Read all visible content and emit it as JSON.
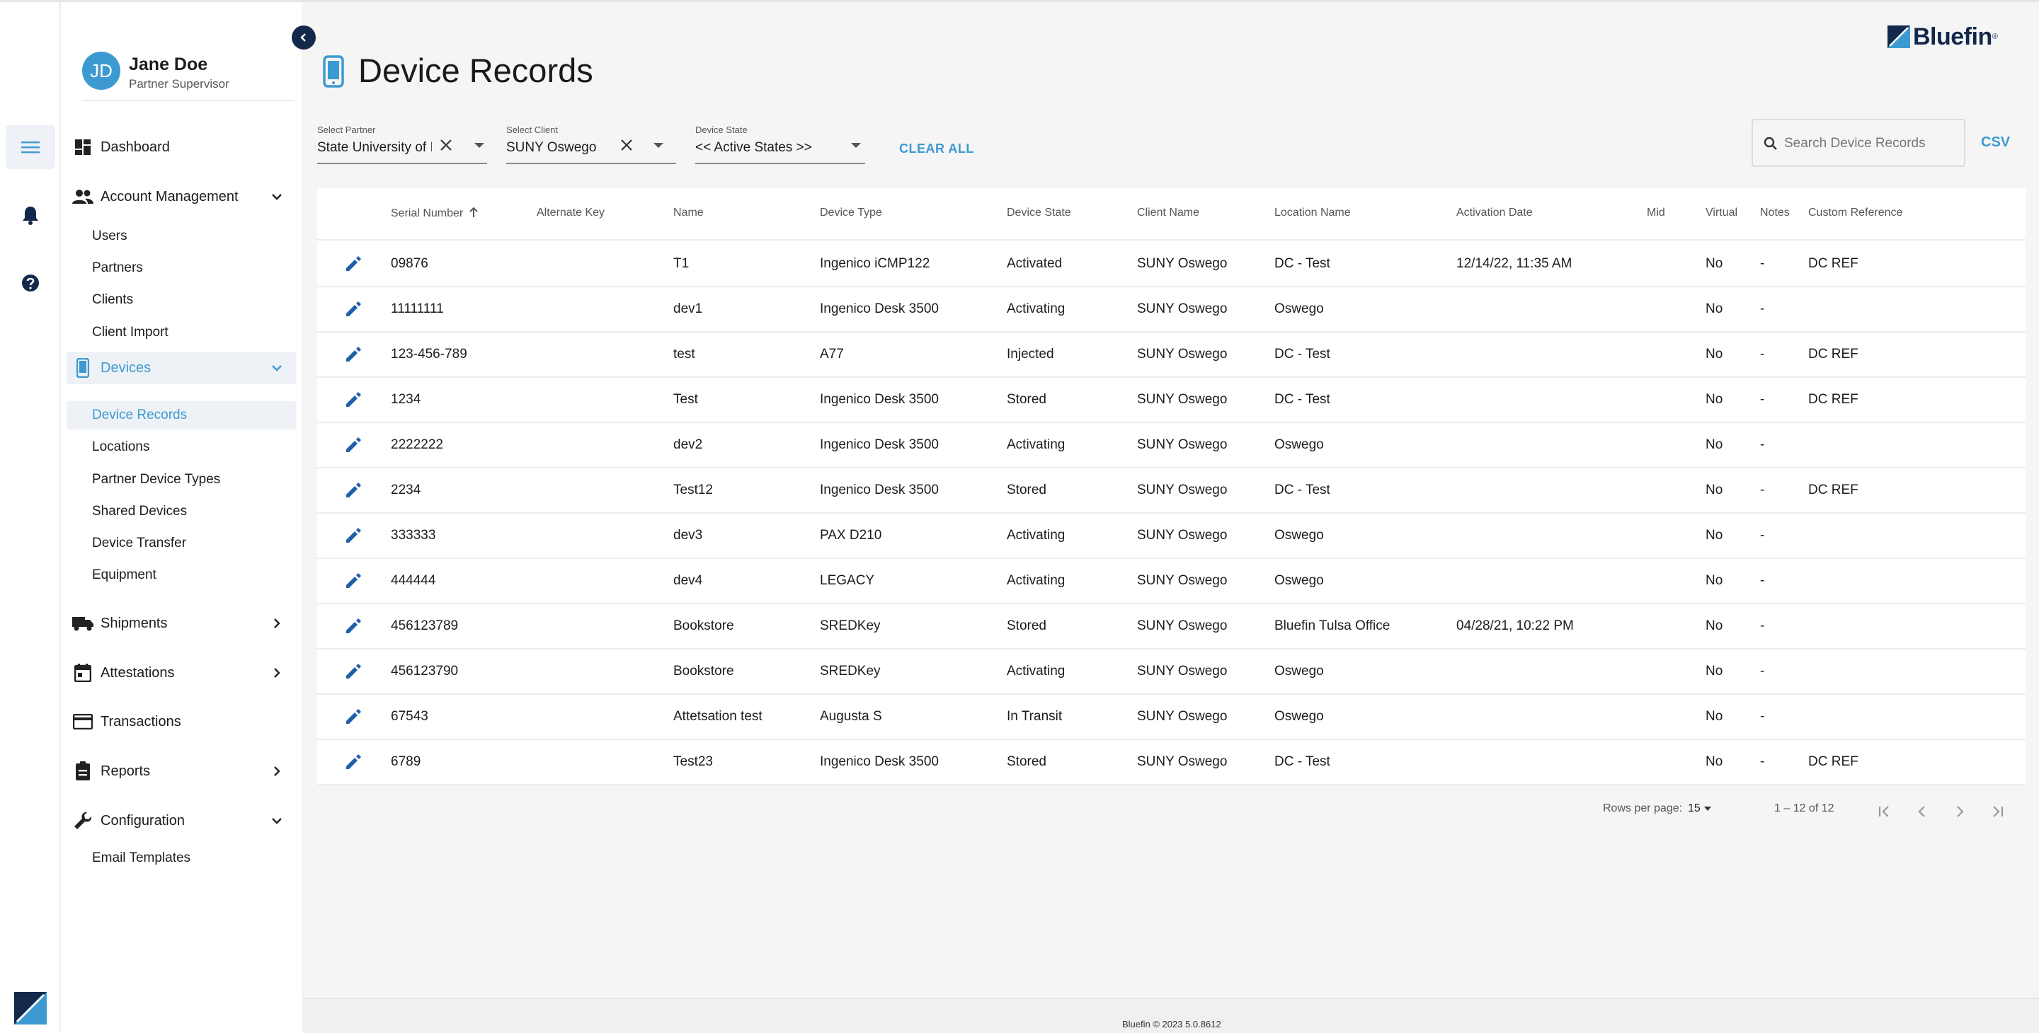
{
  "app": {
    "brand": "Bluefin",
    "brand_reg": "®",
    "footer": "Bluefin © 2023 5.0.8612",
    "colors": {
      "accent": "#3d9ad1",
      "navy": "#13294b",
      "edit_icon": "#1f5fa8"
    }
  },
  "rail": {
    "icons": [
      "menu-icon",
      "bell-icon",
      "help-icon"
    ]
  },
  "user": {
    "initials": "JD",
    "name": "Jane Doe",
    "role": "Partner Supervisor"
  },
  "sidebar": {
    "dashboard": "Dashboard",
    "account_management": "Account Management",
    "users": "Users",
    "partners": "Partners",
    "clients": "Clients",
    "client_import": "Client Import",
    "devices": "Devices",
    "device_records": "Device Records",
    "locations": "Locations",
    "partner_device_types": "Partner Device Types",
    "shared_devices": "Shared Devices",
    "device_transfer": "Device Transfer",
    "equipment": "Equipment",
    "shipments": "Shipments",
    "attestations": "Attestations",
    "transactions": "Transactions",
    "reports": "Reports",
    "configuration": "Configuration",
    "email_templates": "Email Templates"
  },
  "page": {
    "title": "Device Records"
  },
  "filters": {
    "partner": {
      "label": "Select Partner",
      "value": "State University of I"
    },
    "client": {
      "label": "Select Client",
      "value": "SUNY Oswego"
    },
    "state": {
      "label": "Device State",
      "value": "<< Active States >>"
    },
    "clear_all": "CLEAR ALL"
  },
  "search": {
    "placeholder": "Search Device Records"
  },
  "csv": "CSV",
  "table": {
    "headers": {
      "serial": "Serial Number",
      "alt_key": "Alternate Key",
      "name": "Name",
      "device_type": "Device Type",
      "device_state": "Device State",
      "client_name": "Client Name",
      "location_name": "Location Name",
      "activation_date": "Activation Date",
      "mid": "Mid",
      "virtual": "Virtual",
      "notes": "Notes",
      "custom_ref": "Custom Reference"
    },
    "rows": [
      {
        "serial": "09876",
        "alt_key": "",
        "name": "T1",
        "device_type": "Ingenico iCMP122",
        "device_state": "Activated",
        "client_name": "SUNY Oswego",
        "location_name": "DC - Test",
        "activation_date": "12/14/22, 11:35 AM",
        "mid": "",
        "virtual": "No",
        "notes": "-",
        "custom_ref": "DC REF"
      },
      {
        "serial": "11111111",
        "alt_key": "",
        "name": "dev1",
        "device_type": "Ingenico Desk 3500",
        "device_state": "Activating",
        "client_name": "SUNY Oswego",
        "location_name": "Oswego",
        "activation_date": "",
        "mid": "",
        "virtual": "No",
        "notes": "-",
        "custom_ref": ""
      },
      {
        "serial": "123-456-789",
        "alt_key": "",
        "name": "test",
        "device_type": "A77",
        "device_state": "Injected",
        "client_name": "SUNY Oswego",
        "location_name": "DC - Test",
        "activation_date": "",
        "mid": "",
        "virtual": "No",
        "notes": "-",
        "custom_ref": "DC REF"
      },
      {
        "serial": "1234",
        "alt_key": "",
        "name": "Test",
        "device_type": "Ingenico Desk 3500",
        "device_state": "Stored",
        "client_name": "SUNY Oswego",
        "location_name": "DC - Test",
        "activation_date": "",
        "mid": "",
        "virtual": "No",
        "notes": "-",
        "custom_ref": "DC REF"
      },
      {
        "serial": "2222222",
        "alt_key": "",
        "name": "dev2",
        "device_type": "Ingenico Desk 3500",
        "device_state": "Activating",
        "client_name": "SUNY Oswego",
        "location_name": "Oswego",
        "activation_date": "",
        "mid": "",
        "virtual": "No",
        "notes": "-",
        "custom_ref": ""
      },
      {
        "serial": "2234",
        "alt_key": "",
        "name": "Test12",
        "device_type": "Ingenico Desk 3500",
        "device_state": "Stored",
        "client_name": "SUNY Oswego",
        "location_name": "DC - Test",
        "activation_date": "",
        "mid": "",
        "virtual": "No",
        "notes": "-",
        "custom_ref": "DC REF"
      },
      {
        "serial": "333333",
        "alt_key": "",
        "name": "dev3",
        "device_type": "PAX D210",
        "device_state": "Activating",
        "client_name": "SUNY Oswego",
        "location_name": "Oswego",
        "activation_date": "",
        "mid": "",
        "virtual": "No",
        "notes": "-",
        "custom_ref": ""
      },
      {
        "serial": "444444",
        "alt_key": "",
        "name": "dev4",
        "device_type": "LEGACY",
        "device_state": "Activating",
        "client_name": "SUNY Oswego",
        "location_name": "Oswego",
        "activation_date": "",
        "mid": "",
        "virtual": "No",
        "notes": "-",
        "custom_ref": ""
      },
      {
        "serial": "456123789",
        "alt_key": "",
        "name": "Bookstore",
        "device_type": "SREDKey",
        "device_state": "Stored",
        "client_name": "SUNY Oswego",
        "location_name": "Bluefin Tulsa Office",
        "activation_date": "04/28/21, 10:22 PM",
        "mid": "",
        "virtual": "No",
        "notes": "-",
        "custom_ref": ""
      },
      {
        "serial": "456123790",
        "alt_key": "",
        "name": "Bookstore",
        "device_type": "SREDKey",
        "device_state": "Activating",
        "client_name": "SUNY Oswego",
        "location_name": "Oswego",
        "activation_date": "",
        "mid": "",
        "virtual": "No",
        "notes": "-",
        "custom_ref": ""
      },
      {
        "serial": "67543",
        "alt_key": "",
        "name": "Attetsation test",
        "device_type": "Augusta S",
        "device_state": "In Transit",
        "client_name": "SUNY Oswego",
        "location_name": "Oswego",
        "activation_date": "",
        "mid": "",
        "virtual": "No",
        "notes": "-",
        "custom_ref": ""
      },
      {
        "serial": "6789",
        "alt_key": "",
        "name": "Test23",
        "device_type": "Ingenico Desk 3500",
        "device_state": "Stored",
        "client_name": "SUNY Oswego",
        "location_name": "DC - Test",
        "activation_date": "",
        "mid": "",
        "virtual": "No",
        "notes": "-",
        "custom_ref": "DC REF"
      }
    ]
  },
  "pagination": {
    "rows_per_page_label": "Rows per page:",
    "rows_per_page": "15",
    "range": "1 – 12 of 12"
  }
}
